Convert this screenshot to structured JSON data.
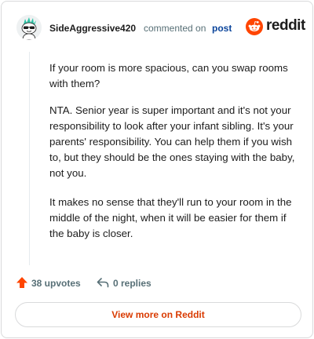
{
  "header": {
    "username": "SideAggressive420",
    "commented_on": "commented on",
    "post_link": "post",
    "brand_wordmark": "reddit",
    "icons": {
      "avatar": "snoo-avatar-icon",
      "logo": "reddit-snoo-icon"
    }
  },
  "comment": {
    "paragraphs": [
      "If your room is more spacious, can you swap rooms with them?",
      "NTA. Senior year is super important and it's not your responsibility to look after your infant sibling. It's your parents' responsibility. You can help them if you wish to, but they should be the ones staying with the baby, not you.",
      "It makes no sense that they'll run to your room in the middle of the night, when it will be easier for them if the baby is closer."
    ]
  },
  "footer": {
    "upvotes_label": "38 upvotes",
    "replies_label": "0 replies",
    "view_more_label": "View more on Reddit",
    "icons": {
      "upvote": "upvote-arrow-icon",
      "reply": "reply-arrow-icon"
    }
  },
  "colors": {
    "accent": "#d93a00",
    "upvote": "#ff4500",
    "link": "#0a449b",
    "muted": "#576f76",
    "text": "#1c1c1c",
    "border": "#d9dadb"
  }
}
